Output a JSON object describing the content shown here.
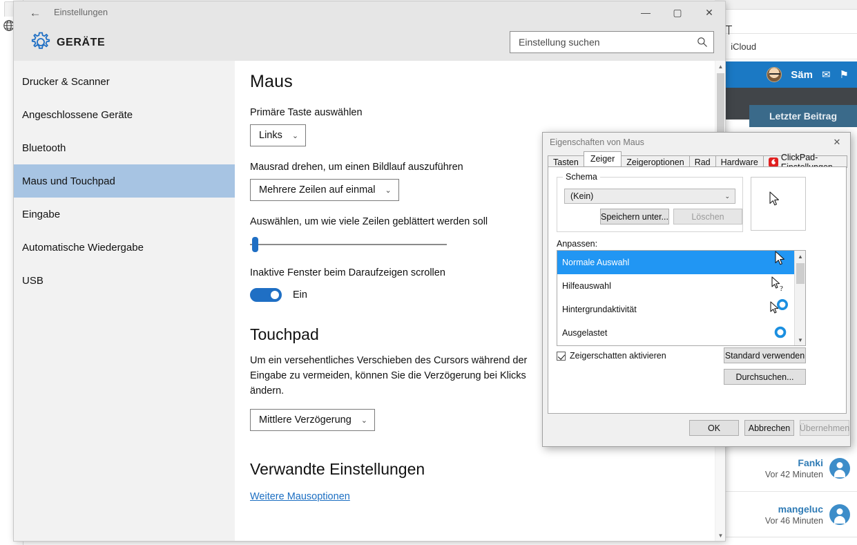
{
  "background_left": {
    "globe_icon": "globe-icon"
  },
  "background_right": {
    "bookmark_label": "iCloud",
    "apple_icon": "apple-icon",
    "user_name": "Säm",
    "mail_icon": "envelope-icon",
    "flag_icon": "flag-icon",
    "last_post_label": "Letzter Beitrag",
    "posts": [
      {
        "name": "Fanki",
        "time": "Vor 42 Minuten"
      },
      {
        "name": "mangeluc",
        "time": "Vor 46 Minuten"
      }
    ]
  },
  "settings_window": {
    "titlebar": {
      "back_icon": "back-arrow-icon",
      "title": "Einstellungen",
      "minimize": "—",
      "maximize": "▢",
      "close": "✕"
    },
    "header": {
      "gear_icon": "gear-icon",
      "app_title": "GERÄTE",
      "search_placeholder": "Einstellung suchen",
      "search_value": "",
      "search_icon": "search-icon"
    },
    "sidebar": {
      "items": [
        {
          "label": "Drucker & Scanner",
          "selected": false
        },
        {
          "label": "Angeschlossene Geräte",
          "selected": false
        },
        {
          "label": "Bluetooth",
          "selected": false
        },
        {
          "label": "Maus und Touchpad",
          "selected": true
        },
        {
          "label": "Eingabe",
          "selected": false
        },
        {
          "label": "Automatische Wiedergabe",
          "selected": false
        },
        {
          "label": "USB",
          "selected": false
        }
      ]
    },
    "main": {
      "heading_mouse": "Maus",
      "primary_button_label": "Primäre Taste auswählen",
      "primary_button_value": "Links",
      "wheel_label": "Mausrad drehen, um einen Bildlauf auszuführen",
      "wheel_value": "Mehrere Zeilen auf einmal",
      "lines_label": "Auswählen, um wie viele Zeilen geblättert werden soll",
      "inactive_label": "Inaktive Fenster beim Daraufzeigen scrollen",
      "inactive_value": "Ein",
      "heading_touchpad": "Touchpad",
      "touchpad_paragraph": "Um ein versehentliches Verschieben des Cursors während der Eingabe zu vermeiden, können Sie die Verzögerung bei Klicks ändern.",
      "touchpad_delay_value": "Mittlere Verzögerung",
      "heading_related": "Verwandte Einstellungen",
      "related_link": "Weitere Mausoptionen",
      "chevron": "⌄"
    }
  },
  "dialog": {
    "title": "Eigenschaften von Maus",
    "close": "✕",
    "tabs": [
      {
        "label": "Tasten",
        "active": false,
        "icon": null
      },
      {
        "label": "Zeiger",
        "active": true,
        "icon": null
      },
      {
        "label": "Zeigeroptionen",
        "active": false,
        "icon": null
      },
      {
        "label": "Rad",
        "active": false,
        "icon": null
      },
      {
        "label": "Hardware",
        "active": false,
        "icon": null
      },
      {
        "label": "ClickPad-Einstellungen",
        "active": false,
        "icon": "clickpad-icon"
      }
    ],
    "schema": {
      "legend": "Schema",
      "value": "(Kein)",
      "chevron": "⌄",
      "save_as_label": "Speichern unter...",
      "delete_label": "Löschen"
    },
    "customize_label": "Anpassen:",
    "cursor_list": [
      {
        "label": "Normale Auswahl",
        "selected": true,
        "cursor": "arrow-cursor-icon"
      },
      {
        "label": "Hilfeauswahl",
        "selected": false,
        "cursor": "arrow-help-cursor-icon"
      },
      {
        "label": "Hintergrundaktivität",
        "selected": false,
        "cursor": "arrow-busy-cursor-icon"
      },
      {
        "label": "Ausgelastet",
        "selected": false,
        "cursor": "busy-ring-cursor-icon"
      }
    ],
    "shadow_checkbox_label": "Zeigerschatten aktivieren",
    "shadow_checkbox_checked": true,
    "use_default_label": "Standard verwenden",
    "browse_label": "Durchsuchen...",
    "footer": {
      "ok_label": "OK",
      "cancel_label": "Abbrechen",
      "apply_label": "Übernehmen",
      "apply_disabled": true
    },
    "preview_cursor": "arrow-cursor-icon"
  },
  "colors": {
    "accent_blue": "#1f6fc4",
    "selection_blue": "#2196f3",
    "sidebar_selected": "#a7c4e3",
    "link_blue": "#1b6ec2",
    "forum_blue": "#1b79c4",
    "clickpad_red": "#e02020"
  }
}
